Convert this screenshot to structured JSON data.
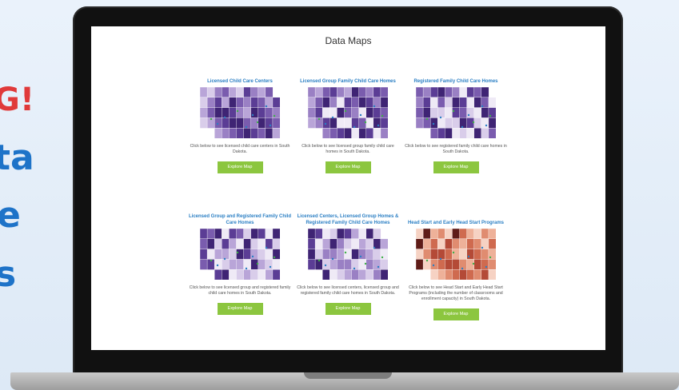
{
  "promo": {
    "line1": "G!",
    "line2": "ta",
    "line3": "e",
    "line4": "s"
  },
  "page": {
    "title": "Data Maps"
  },
  "colors": {
    "link_blue": "#2b7fc4",
    "button_green": "#8cc63f",
    "map_purple": "#6a4ba3",
    "map_red": "#b4443a"
  },
  "cards": [
    {
      "title": "Licensed Child Care Centers",
      "description": "Click below to see licensed child care centers in South Dakota.",
      "button": "Explore Map",
      "map_theme": "purple"
    },
    {
      "title": "Licensed Group Family Child Care Homes",
      "description": "Click below to see licensed group family child care homes in South Dakota.",
      "button": "Explore Map",
      "map_theme": "purple"
    },
    {
      "title": "Registered Family Child Care Homes",
      "description": "Click below to see registered family child care homes in South Dakota.",
      "button": "Explore Map",
      "map_theme": "purple"
    },
    {
      "title": "Licensed Group and Registered Family Child Care Homes",
      "description": "Click below to see licensed group and registered family child care homes in South Dakota.",
      "button": "Explore Map",
      "map_theme": "purple"
    },
    {
      "title": "Licensed Centers, Licensed Group Homes & Registered Family Child Care Homes",
      "description": "Click below to see licensed centers, licensed group and registered family child care homes in South Dakota.",
      "button": "Explore Map",
      "map_theme": "purple"
    },
    {
      "title": "Head Start and Early Head Start Programs",
      "description": "Click below to see Head Start and Early Head Start Programs (including the number of classrooms and enrollment capacity) in South Dakota.",
      "button": "Explore Map",
      "map_theme": "red"
    }
  ]
}
